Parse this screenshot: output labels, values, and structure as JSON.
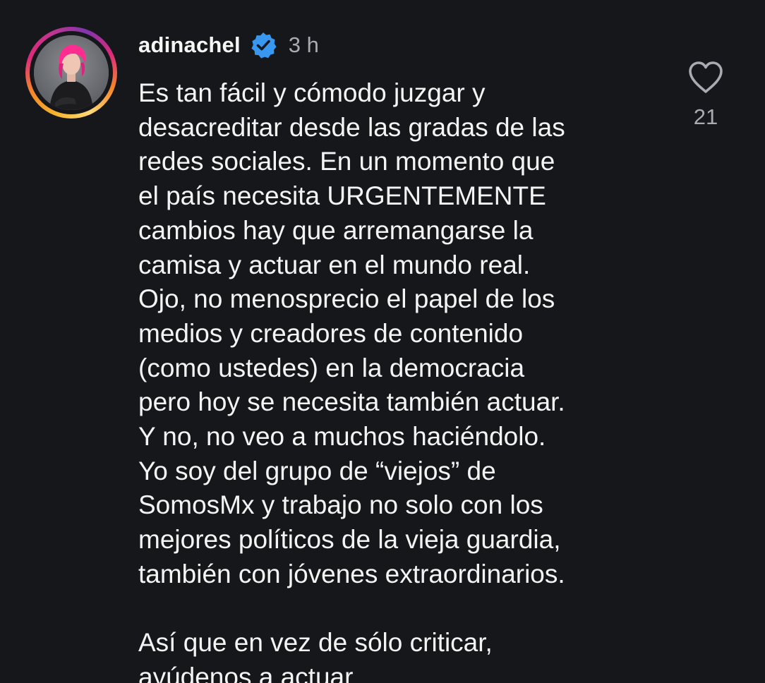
{
  "comment": {
    "username": "adinachel",
    "verified": true,
    "verified_icon": "verified-badge-icon",
    "timestamp": "3 h",
    "text": "Es tan fácil y cómodo juzgar y\ndesacreditar desde las gradas de las\nredes sociales. En un momento que\nel país necesita URGENTEMENTE\ncambios hay que arremangarse la\ncamisa y actuar en el mundo real.\nOjo, no menosprecio el papel de los\nmedios y creadores de contenido\n(como ustedes) en la democracia\npero hoy se necesita también actuar.\nY no, no veo a muchos haciéndolo.\nYo soy del grupo de “viejos” de\nSomosMx y trabajo no solo con los\nmejores políticos de la vieja guardia,\ntambién con jóvenes extraordinarios.\n\nAsí que en vez de sólo criticar,\nayúdenos a actuar.",
    "like_icon": "heart-outline-icon",
    "like_count": "21"
  },
  "colors": {
    "background": "#16171b",
    "text": "#f4f4f4",
    "muted": "#a8abb1",
    "verified_blue": "#3897f0"
  }
}
